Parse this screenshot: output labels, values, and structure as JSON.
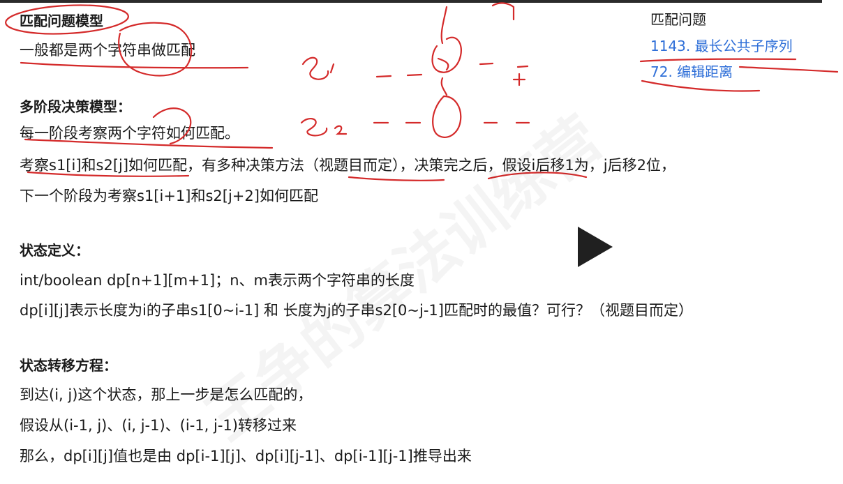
{
  "sidebar": {
    "title": "匹配问题",
    "links": [
      "1143. 最长公共子序列",
      "72. 编辑距离"
    ]
  },
  "sections": {
    "match_title": "匹配问题模型",
    "match_desc": "一般都是两个字符串做匹配",
    "multi_title": "多阶段决策模型：",
    "multi_lines": [
      "每一阶段考察两个字符如何匹配。",
      "考察s1[i]和s2[j]如何匹配，有多种决策方法（视题目而定），决策完之后，假设i后移1为，j后移2位，",
      "下一个阶段为考察s1[i+1]和s2[j+2]如何匹配"
    ],
    "state_title": "状态定义：",
    "state_lines": [
      "int/boolean dp[n+1][m+1]；n、m表示两个字符串的长度",
      "dp[i][j]表示长度为i的子串s1[0~i-1] 和 长度为j的子串s2[0~j-1]匹配时的最值？可行？（视题目而定）"
    ],
    "trans_title": "状态转移方程：",
    "trans_lines": [
      "到达(i, j)这个状态，那上一步是怎么匹配的，",
      "假设从(i-1, j)、(i, j-1)、(i-1, j-1)转移过来",
      "那么，dp[i][j]值也是由 dp[i-1][j]、dp[i][j-1]、dp[i-1][j-1]推导出来"
    ]
  },
  "colors": {
    "link": "#2f6fd8",
    "annotation": "#d42a2a",
    "play_button": "#202020"
  },
  "icons": {
    "play": "play-icon"
  }
}
